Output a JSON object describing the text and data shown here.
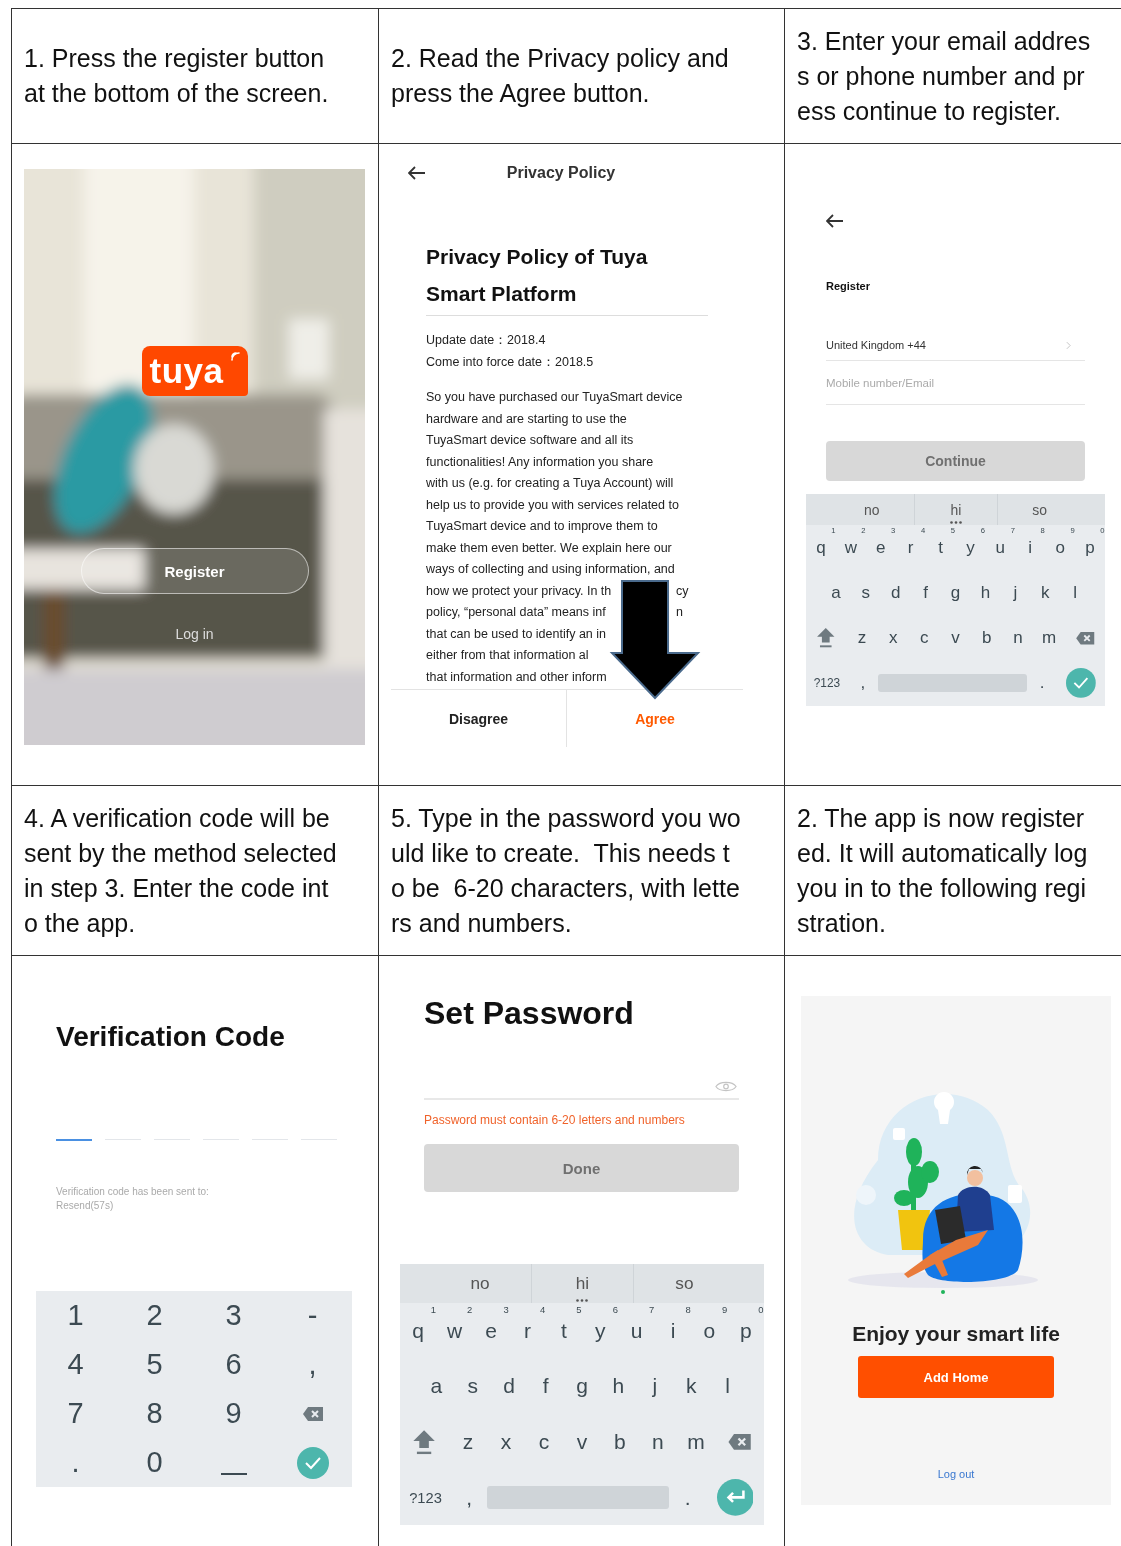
{
  "steps": [
    "1. Press the register button\nat the bottom of the screen.",
    "2. Read the Privacy policy and\npress the Agree button.",
    "3. Enter your email addres\ns or phone number and pr\ness continue to register.",
    "4. A verification code will be\nsent by the method selected\nin step 3. Enter the code int\no the app.",
    "5. Type in the password you wo\nuld like to create.  This needs t\no be  6-20 characters, with lette\nrs and numbers.",
    "2. The app is now register\ned. It will automatically log\nyou in to the following regi\nstration."
  ],
  "screens": [
    {
      "kind": "welcome",
      "logo": "tuya",
      "register": "Register",
      "login": "Log in"
    },
    {
      "kind": "policy",
      "title": "Privacy Policy",
      "heading": "Privacy Policy of Tuya Smart Platform",
      "dates": [
        "Update date：2018.4",
        "Come into force date：2018.5"
      ],
      "lines": [
        {
          "text": "So you have purchased our TuyaSmart device"
        },
        {
          "text": "hardware and are starting to use the"
        },
        {
          "text": "TuyaSmart device software and all its"
        },
        {
          "text": "functionalities! Any information you share"
        },
        {
          "text": "with us (e.g. for creating a Tuya Account) will"
        },
        {
          "text": "help us to provide you with services related to"
        },
        {
          "text": "TuyaSmart device and to improve them to"
        },
        {
          "text": "make them even better. We explain here our"
        },
        {
          "text": "ways of collecting and using information, and"
        },
        {
          "text": "how we protect your privacy. In th",
          "tail": "cy"
        },
        {
          "text": "policy, “personal data” means inf",
          "tail": "n"
        },
        {
          "text": "that can be used to identify an in"
        },
        {
          "text": "either from that information al"
        },
        {
          "text": "that information and other inform"
        }
      ],
      "buttons": [
        {
          "label": "Disagree",
          "primary": false
        },
        {
          "label": "Agree",
          "primary": true
        }
      ]
    },
    {
      "kind": "register",
      "title": "Register",
      "country": "United Kingdom +44",
      "placeholder": "Mobile number/Email",
      "button": {
        "label": "Continue",
        "disabled": true
      },
      "keyboard": {
        "suggestions": [
          {
            "text": "no",
            "more": false
          },
          {
            "text": "hi",
            "more": true
          },
          {
            "text": "so",
            "more": false
          }
        ],
        "rows": [
          {
            "keys": [
              {
                "key": "q",
                "hint": "1"
              },
              {
                "key": "w",
                "hint": "2"
              },
              {
                "key": "e",
                "hint": "3"
              },
              {
                "key": "r",
                "hint": "4"
              },
              {
                "key": "t",
                "hint": "5"
              },
              {
                "key": "y",
                "hint": "6"
              },
              {
                "key": "u",
                "hint": "7"
              },
              {
                "key": "i",
                "hint": "8"
              },
              {
                "key": "o",
                "hint": "9"
              },
              {
                "key": "p",
                "hint": "0"
              }
            ]
          },
          {
            "keys": [
              {
                "key": "a"
              },
              {
                "key": "s"
              },
              {
                "key": "d"
              },
              {
                "key": "f"
              },
              {
                "key": "g"
              },
              {
                "key": "h"
              },
              {
                "key": "j"
              },
              {
                "key": "k"
              },
              {
                "key": "l"
              }
            ]
          },
          {
            "keys": [
              {
                "key": "z"
              },
              {
                "key": "x"
              },
              {
                "key": "c"
              },
              {
                "key": "v"
              },
              {
                "key": "b"
              },
              {
                "key": "n"
              },
              {
                "key": "m"
              }
            ]
          }
        ],
        "symbols": "?123",
        "comma": ",",
        "period": ".",
        "action": {
          "kind": "done"
        }
      }
    },
    {
      "kind": "verify",
      "title": "Verification Code",
      "slots": [
        {
          "selected": true
        },
        {
          "selected": false
        },
        {
          "selected": false
        },
        {
          "selected": false
        },
        {
          "selected": false
        },
        {
          "selected": false
        }
      ],
      "message": "Verification code has been sent to:",
      "resend": "Resend(57s)",
      "numpad": [
        {
          "kind": "char",
          "label": "1"
        },
        {
          "kind": "char",
          "label": "2"
        },
        {
          "kind": "char",
          "label": "3"
        },
        {
          "kind": "char",
          "label": "-"
        },
        {
          "kind": "char",
          "label": "4"
        },
        {
          "kind": "char",
          "label": "5"
        },
        {
          "kind": "char",
          "label": "6"
        },
        {
          "kind": "char",
          "label": ","
        },
        {
          "kind": "char",
          "label": "7"
        },
        {
          "kind": "char",
          "label": "8"
        },
        {
          "kind": "char",
          "label": "9"
        },
        {
          "kind": "backspace"
        },
        {
          "kind": "char",
          "label": "."
        },
        {
          "kind": "char",
          "label": "0"
        },
        {
          "kind": "space"
        },
        {
          "kind": "done"
        }
      ]
    },
    {
      "kind": "password",
      "title": "Set Password",
      "error": "Password must contain 6-20 letters and numbers",
      "button": {
        "label": "Done",
        "disabled": true
      },
      "keyboard": {
        "suggestions": [
          {
            "text": "no",
            "more": false
          },
          {
            "text": "hi",
            "more": true
          },
          {
            "text": "so",
            "more": false
          }
        ],
        "rows": [
          {
            "keys": [
              {
                "key": "q",
                "hint": "1"
              },
              {
                "key": "w",
                "hint": "2"
              },
              {
                "key": "e",
                "hint": "3"
              },
              {
                "key": "r",
                "hint": "4"
              },
              {
                "key": "t",
                "hint": "5"
              },
              {
                "key": "y",
                "hint": "6"
              },
              {
                "key": "u",
                "hint": "7"
              },
              {
                "key": "i",
                "hint": "8"
              },
              {
                "key": "o",
                "hint": "9"
              },
              {
                "key": "p",
                "hint": "0"
              }
            ]
          },
          {
            "keys": [
              {
                "key": "a"
              },
              {
                "key": "s"
              },
              {
                "key": "d"
              },
              {
                "key": "f"
              },
              {
                "key": "g"
              },
              {
                "key": "h"
              },
              {
                "key": "j"
              },
              {
                "key": "k"
              },
              {
                "key": "l"
              }
            ]
          },
          {
            "keys": [
              {
                "key": "z"
              },
              {
                "key": "x"
              },
              {
                "key": "c"
              },
              {
                "key": "v"
              },
              {
                "key": "b"
              },
              {
                "key": "n"
              },
              {
                "key": "m"
              }
            ]
          }
        ],
        "symbols": "?123",
        "comma": ",",
        "period": ".",
        "action": {
          "kind": "enter"
        }
      }
    },
    {
      "kind": "home",
      "title": "Enjoy your smart life",
      "button": "Add Home",
      "link": "Log out"
    }
  ]
}
